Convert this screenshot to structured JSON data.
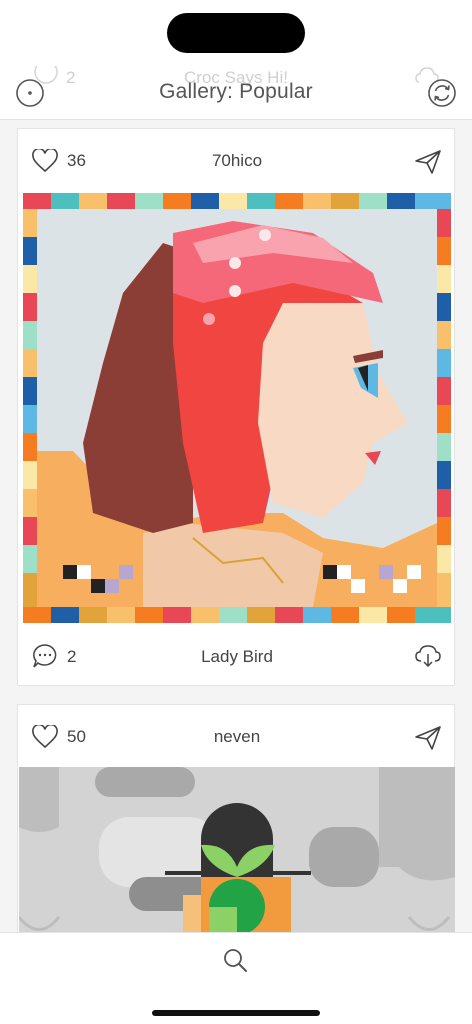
{
  "header": {
    "title": "Gallery: Popular",
    "previous_card": {
      "comment_count": "2",
      "title": "Croc Says Hi!"
    }
  },
  "cards": [
    {
      "likes": "36",
      "author": "70hico",
      "comments": "2",
      "title": "Lady Bird",
      "palette": {
        "background": "#dce3e7",
        "hair_dark": "#8b3e36",
        "hair_red": "#f04540",
        "hat_pink": "#f4687a",
        "skin": "#f8d9c3",
        "ground": "#f7ae5f",
        "eye": "#5db8e4"
      }
    },
    {
      "likes": "50",
      "author": "neven",
      "palette": {
        "background": "#d3d3d3",
        "shape_gray": "#a9a9a9",
        "hat": "#333333",
        "leaf": "#8bd166",
        "pot": "#f19a3e"
      }
    }
  ],
  "icons": {
    "menu": "circle-dot-icon",
    "refresh": "refresh-icon",
    "like": "heart-icon",
    "share": "paper-plane-icon",
    "comment": "speech-bubble-icon",
    "download": "cloud-download-icon",
    "search": "search-icon"
  }
}
